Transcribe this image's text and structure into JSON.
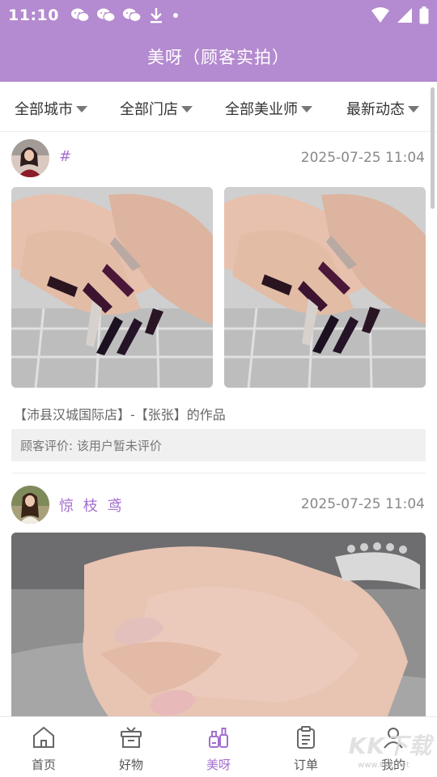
{
  "status_bar": {
    "time": "11:10",
    "left_icons": [
      "wechat-icon",
      "wechat-icon",
      "wechat-icon",
      "download-icon",
      "dot-icon"
    ],
    "right_icons": [
      "wifi-icon",
      "signal-icon",
      "battery-icon"
    ]
  },
  "header": {
    "title": "美呀（顾客实拍）",
    "background_color": "#b48ad0"
  },
  "filters": [
    {
      "label": "全部城市",
      "icon": "caret-down-icon"
    },
    {
      "label": "全部门店",
      "icon": "caret-down-icon"
    },
    {
      "label": "全部美业师",
      "icon": "caret-down-icon"
    },
    {
      "label": "最新动态",
      "icon": "caret-down-icon"
    }
  ],
  "posts": [
    {
      "user_name": "#",
      "time": "2025-07-25 11:04",
      "credit": "【沛县汉城国际店】-【张张】的作品",
      "review": "顾客评价:  该用户暂未评价"
    },
    {
      "user_name": "惊 枝 鸢",
      "time": "2025-07-25 11:04"
    }
  ],
  "bottom_nav": [
    {
      "label": "首页",
      "icon": "home-icon"
    },
    {
      "label": "好物",
      "icon": "gift-box-icon"
    },
    {
      "label": "美呀",
      "icon": "nail-polish-icon",
      "active": true
    },
    {
      "label": "订单",
      "icon": "clipboard-icon"
    },
    {
      "label": "我的",
      "icon": "user-icon"
    }
  ],
  "watermark": {
    "main": "KK下载",
    "sub": "www.kkx.net"
  },
  "colors": {
    "accent": "#a46fcf",
    "active_nav": "#a46fcf"
  }
}
